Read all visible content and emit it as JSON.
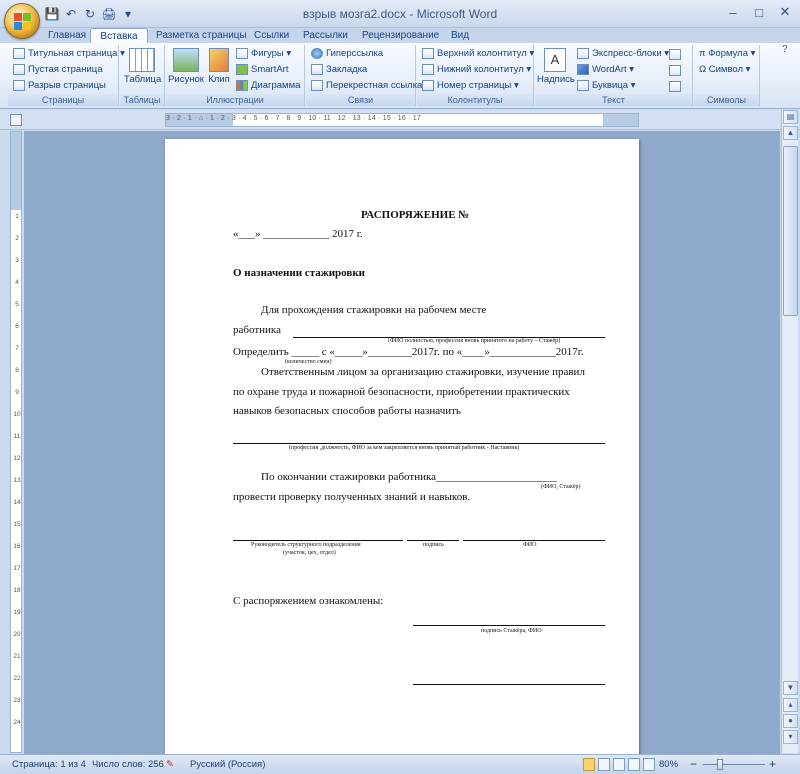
{
  "window": {
    "title": "взрыв мозга2.docx - Microsoft Word",
    "controls": {
      "minimize": "–",
      "maximize": "□",
      "close": "✕"
    }
  },
  "qat": {
    "save": "💾",
    "undo": "↶",
    "redo": "↻",
    "print_preview": "🖨",
    "dropdown": "▾"
  },
  "tabs": [
    {
      "label": "Главная"
    },
    {
      "label": "Вставка",
      "active": true
    },
    {
      "label": "Разметка страницы"
    },
    {
      "label": "Ссылки"
    },
    {
      "label": "Рассылки"
    },
    {
      "label": "Рецензирование"
    },
    {
      "label": "Вид"
    }
  ],
  "ribbon": {
    "pages": {
      "label": "Страницы",
      "cover": "Титульная страница ▾",
      "blank": "Пустая страница",
      "break": "Разрыв страницы"
    },
    "tables": {
      "label": "Таблицы",
      "table": "Таблица"
    },
    "illustrations": {
      "label": "Иллюстрации",
      "picture": "Рисунок",
      "clip": "Клип",
      "shapes": "Фигуры ▾",
      "smartart": "SmartArt",
      "chart": "Диаграмма"
    },
    "links": {
      "label": "Связи",
      "hyperlink": "Гиперссылка",
      "bookmark": "Закладка",
      "crossref": "Перекрестная ссылка"
    },
    "headers": {
      "label": "Колонтитулы",
      "header": "Верхний колонтитул ▾",
      "footer": "Нижний колонтитул ▾",
      "pagenum": "Номер страницы ▾"
    },
    "text": {
      "label": "Текст",
      "textbox": "Надпись",
      "express": "Экспресс-блоки ▾",
      "wordart": "WordArt ▾",
      "dropcap": "Буквица ▾"
    },
    "symbols": {
      "label": "Символы",
      "formula": "π Формула ▾",
      "symbol": "Ω Символ ▾"
    }
  },
  "ruler": {
    "h_numbers": "3 · 2 · 1 · ⌂ · 1 · 2 · 3 · 4 · 5 · 6 · 7 · 8 · 9 · 10 · 11 · 12 · 13 · 14 · 15 · 16 · 17",
    "v_numbers": [
      "1",
      "2",
      "3",
      "4",
      "5",
      "6",
      "7",
      "8",
      "9",
      "10",
      "11",
      "12",
      "13",
      "14",
      "15",
      "16",
      "17",
      "18",
      "19",
      "20",
      "21",
      "22",
      "23",
      "24"
    ]
  },
  "document": {
    "title": "РАСПОРЯЖЕНИЕ №",
    "date": "«___»  ____________  2017 г.",
    "subject": "О назначении стажировки",
    "p1_line1": "Для прохождения стажировки на рабочем месте",
    "p1_worker": "работника",
    "note_fio": "(ФИО полностью, профессия вновь принятого на работу – Стажёр)",
    "p2": "Определить  _____  с  «_____»________2017г. по «____»____________2017г.",
    "note_shifts": "(количество смен)",
    "p3_line1": "Ответственным лицом за организацию стажировки, изучение правил",
    "p3_line2": "по охране труда и пожарной безопасности, приобретении практических",
    "p3_line3": "навыков безопасных способов работы назначить",
    "note_mentor": "(профессия ,должность, ФИО за кем закрепляется вновь принятый работник - Наставник)",
    "p4_line1": "По окончании стажировки работника______________________",
    "note_trainee": "(ФИО, Стажёр)",
    "p4_line2": "провести проверку полученных знаний и навыков.",
    "sig_head": "Руководитель структурного подразделения",
    "sig_head2": "(участок, цех, отдел)",
    "sig_sign": "подпись",
    "sig_fio": "ФИО",
    "acquainted": "С распоряжением ознакомлены:",
    "sig_trainee": "подпись Стажёра, ФИО"
  },
  "status": {
    "page": "Страница: 1 из 4",
    "words": "Число слов: 256",
    "language": "Русский (Россия)",
    "zoom": "80%",
    "zoom_minus": "−",
    "zoom_plus": "+"
  }
}
